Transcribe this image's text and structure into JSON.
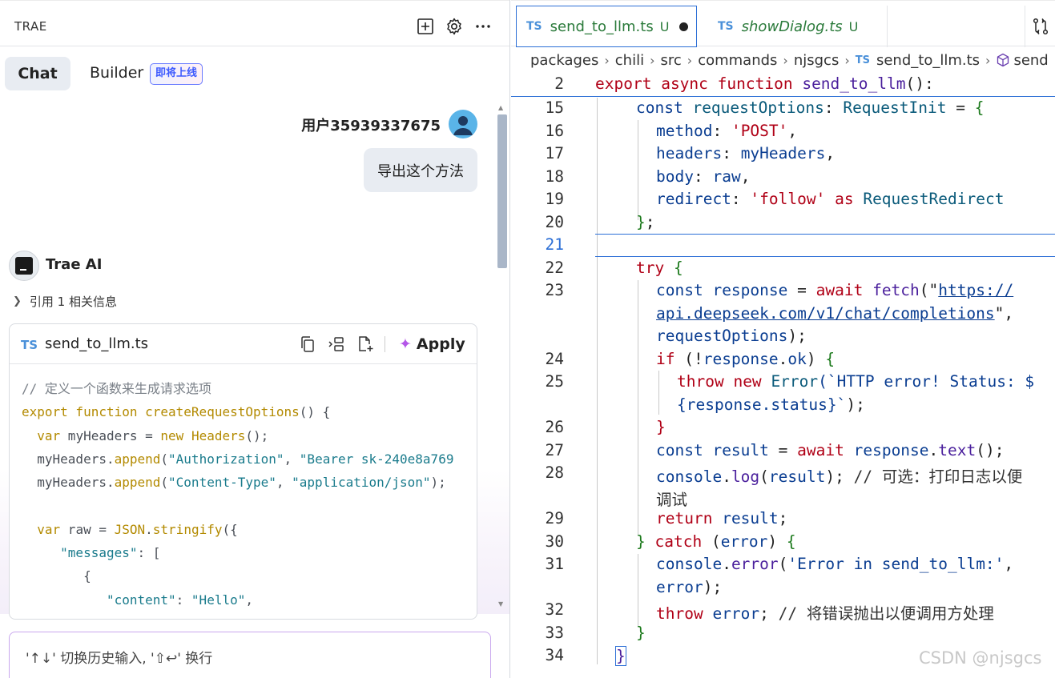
{
  "left_panel": {
    "title": "TRAE",
    "header_icons": [
      "new-chat-icon",
      "gear-icon",
      "more-icon"
    ],
    "tabs": {
      "chat": "Chat",
      "builder": "Builder",
      "builder_badge": "即将上线"
    },
    "user": {
      "name": "用户35939337675",
      "message": "导出这个方法"
    },
    "ai": {
      "name": "Trae AI",
      "reference": "引用 1 相关信息"
    },
    "code_card": {
      "lang": "TS",
      "file": "send_to_llm.ts",
      "actions": [
        "copy-icon",
        "insert-icon",
        "new-file-icon"
      ],
      "apply": "Apply",
      "lines": [
        "// 定义一个函数来生成请求选项",
        "export function createRequestOptions() {",
        "  var myHeaders = new Headers();",
        "  myHeaders.append(\"Authorization\", \"Bearer sk-240e8a769",
        "  myHeaders.append(\"Content-Type\", \"application/json\");",
        "",
        "  var raw = JSON.stringify({",
        "     \"messages\": [",
        "        {",
        "           \"content\": \"Hello\","
      ]
    },
    "input_placeholder": "'↑↓' 切换历史输入, '⇧↩' 换行"
  },
  "editor": {
    "tabs": [
      {
        "lang": "TS",
        "name": "send_to_llm.ts",
        "status": "U",
        "active": true,
        "dirty": true
      },
      {
        "lang": "TS",
        "name": "showDialog.ts",
        "status": "U",
        "active": false,
        "dirty": false
      }
    ],
    "breadcrumb": [
      "packages",
      "chili",
      "src",
      "commands",
      "njsgcs",
      "send_to_llm.ts",
      "send"
    ],
    "sticky": {
      "line": "2",
      "text": "export async function send_to_llm():"
    },
    "line_numbers": [
      "15",
      "16",
      "17",
      "18",
      "19",
      "20",
      "21",
      "22",
      "23",
      "24",
      "25",
      "26",
      "27",
      "28",
      "29",
      "30",
      "31",
      "32",
      "33",
      "34"
    ],
    "code": {
      "l15": [
        "const",
        "requestOptions",
        ":",
        "RequestInit",
        "=",
        "{"
      ],
      "l16": [
        "method",
        ":",
        "'POST'",
        ","
      ],
      "l17": [
        "headers",
        ":",
        "myHeaders",
        ","
      ],
      "l18": [
        "body",
        ":",
        "raw",
        ","
      ],
      "l19": [
        "redirect",
        ":",
        "'follow'",
        "as",
        "RequestRedirect"
      ],
      "l20": [
        "}",
        ";"
      ],
      "l22": [
        "try",
        "{"
      ],
      "l23a": [
        "const",
        "response",
        "=",
        "await",
        "fetch",
        "(\"",
        "https://"
      ],
      "l23b": [
        "api.deepseek.com/v1/chat/completions",
        "\",",
        ""
      ],
      "l23c": [
        "requestOptions",
        ");"
      ],
      "l24": [
        "if",
        "(!",
        "response",
        ".",
        "ok",
        ")",
        "{"
      ],
      "l25a": [
        "throw",
        "new",
        "Error",
        "(`HTTP error! Status: $"
      ],
      "l25b": [
        "{response.status}`",
        ");"
      ],
      "l26": [
        "}"
      ],
      "l27": [
        "const",
        "result",
        "=",
        "await",
        "response",
        ".",
        "text",
        "();"
      ],
      "l28a": [
        "console",
        ".",
        "log",
        "(",
        "result",
        ");",
        "// 可选：打印日志以便"
      ],
      "l28b": [
        "调试"
      ],
      "l29": [
        "return",
        "result",
        ";"
      ],
      "l30": [
        "}",
        "catch",
        "(",
        "error",
        ")",
        "{"
      ],
      "l31a": [
        "console",
        ".",
        "error",
        "(",
        "'Error in send_to_llm:'",
        ","
      ],
      "l31b": [
        "error",
        ");"
      ],
      "l32": [
        "throw",
        "error",
        ";",
        "// 将错误抛出以便调用方处理"
      ],
      "l33": [
        "}"
      ],
      "l34": [
        "}"
      ]
    },
    "watermark": "CSDN @njsgcs"
  },
  "colors": {
    "keyword": "#b00016",
    "accent_blue": "#2c6fd6",
    "ts_tag": "#4a90d9",
    "untracked_green": "#2a7a3a"
  }
}
